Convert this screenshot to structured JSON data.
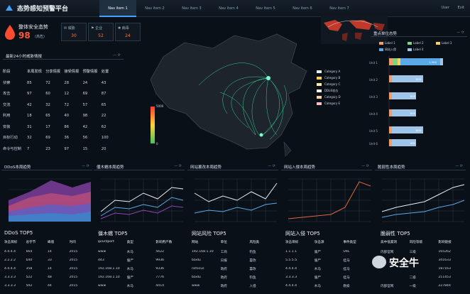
{
  "app": {
    "title": "态势感知预警平台"
  },
  "nav": [
    "Nav item 1",
    "Nav item 2",
    "Nav item 3",
    "Nav item 4",
    "Nav item 5",
    "Nav item 6",
    "Nav item 7"
  ],
  "user": {
    "name": "User",
    "action": "Exit"
  },
  "status": {
    "title": "整体安全态势",
    "score": "98",
    "note": "(高危)",
    "kpis": [
      {
        "label": "威胁",
        "value": "30"
      },
      {
        "label": "企业",
        "value": "52"
      },
      {
        "label": "病毒",
        "value": "24"
      }
    ]
  },
  "threat_panel": {
    "title": "最新24小时威胁情报",
    "columns": [
      "阶段",
      "本周发现",
      "分享情报",
      "接受情报",
      "预警情报",
      "处置"
    ],
    "rows": [
      [
        "侦察",
        "85",
        "72",
        "28",
        "24",
        "43"
      ],
      [
        "攻击",
        "97",
        "60",
        "12",
        "69",
        "87"
      ],
      [
        "交流",
        "42",
        "32",
        "72",
        "57",
        "65"
      ],
      [
        "利用",
        "18",
        "65",
        "40",
        "98",
        "22"
      ],
      [
        "安装",
        "31",
        "17",
        "86",
        "42",
        "62"
      ],
      [
        "目标行动",
        "32",
        "69",
        "36",
        "56",
        "100"
      ],
      [
        "命令与控制",
        "7",
        "23",
        "97",
        "15",
        "20"
      ]
    ]
  },
  "map": {
    "legend_max": "5000",
    "legend_min": "0",
    "legend": [
      {
        "label": "Category A",
        "color": "#e9eef3"
      },
      {
        "label": "Category B",
        "color": "#f4d35e"
      },
      {
        "label": "Category C",
        "color": "#ffe9a8"
      },
      {
        "label": "DDoS攻击",
        "color": "#f3f3f3"
      },
      {
        "label": "Category D",
        "color": "#ffd6a0"
      },
      {
        "label": "Category E",
        "color": "#f5c0c0"
      }
    ]
  },
  "key_units": {
    "title": "重点单位态势",
    "legend": [
      {
        "label": "Label 1",
        "color": "#f39c6b"
      },
      {
        "label": "Label 2",
        "color": "#7fd37f"
      },
      {
        "label": "Label 3",
        "color": "#f4d35e"
      },
      {
        "label": "网站入侵",
        "color": "#5aa9e6"
      },
      {
        "label": "Label 4",
        "color": "#9fc5e8"
      }
    ],
    "bars": [
      {
        "name": "Unit 1",
        "value": "1,000"
      },
      {
        "name": "Unit 2",
        "value": "800"
      },
      {
        "name": "Unit 3",
        "value": "600"
      },
      {
        "name": "Unit 4",
        "value": "600"
      },
      {
        "name": "Unit 5",
        "value": "800"
      },
      {
        "name": "Unit 6",
        "value": "600"
      }
    ]
  },
  "mini_panels": [
    {
      "title": "DDoS本周趋势"
    },
    {
      "title": "僵木蠕本周趋势"
    },
    {
      "title": "网站篡改本周趋势"
    },
    {
      "title": "网站入侵本周趋势"
    },
    {
      "title": "脆弱性本周趋势"
    }
  ],
  "top5": [
    {
      "title": "DDoS TOP5",
      "columns": [
        "攻击目标",
        "总字节",
        "峰值",
        "时间"
      ],
      "rows": [
        [
          "4.4.4.4",
          "664",
          "14",
          "2015"
        ],
        [
          "2.2.2.2",
          "640",
          "33",
          "2015"
        ],
        [
          "4.4.4.4",
          "358",
          "14",
          "2015"
        ],
        [
          "3.3.3.3",
          "522",
          "48",
          "2015"
        ],
        [
          "3.3.3.3",
          "592",
          "44",
          "2015"
        ]
      ]
    },
    {
      "title": "僵木蠕 TOP5",
      "columns": [
        "ip/url/port",
        "类型",
        "影响用户数"
      ],
      "rows": [
        [
          "www",
          "木马",
          "5622"
        ],
        [
          "443",
          "僵尸",
          "9936"
        ],
        [
          "192.168.1.10",
          "木马",
          "9336"
        ],
        [
          "192.168.1.10",
          "僵尸",
          "7776"
        ],
        [
          "www",
          "木马",
          "4414"
        ]
      ]
    },
    {
      "title": "网站风险 TOP5",
      "columns": [
        "网站",
        "单位",
        "风险类"
      ],
      "rows": [
        [
          "192.168.1.10",
          "工商",
          "钓鱼"
        ],
        [
          "baidu",
          "日报",
          "篡改"
        ],
        [
          "nsfocus",
          "政府",
          "篡改"
        ],
        [
          "baidu",
          "政府",
          "钓鱼"
        ],
        [
          "www",
          "政府",
          "入侵"
        ]
      ]
    },
    {
      "title": "网站入侵 TOP5",
      "columns": [
        "攻击目标",
        "攻击源",
        "事件类型"
      ],
      "rows": [
        [
          "1.1.1.1",
          "僵尸",
          "URL"
        ],
        [
          "5.5.5.5",
          "僵尸",
          "挂马"
        ],
        [
          "4.4.4.4",
          "木马",
          "挂马"
        ],
        [
          "3.3.3.3",
          "僵尸",
          "挂马"
        ],
        [
          "4.4.4.4",
          "木马",
          "勒索"
        ]
      ]
    },
    {
      "title": "脆弱性 TOP5",
      "columns": [
        "高中低漏洞",
        "风险等级",
        "影响链接"
      ],
      "rows": [
        [
          "内部官网",
          "三级",
          "165262"
        ],
        [
          "",
          "",
          "341633"
        ],
        [
          "",
          "",
          "187163"
        ],
        [
          "",
          "二级",
          "211453"
        ],
        [
          "内部官网",
          "一级",
          "227844"
        ]
      ]
    }
  ],
  "watermark": "安全牛"
}
